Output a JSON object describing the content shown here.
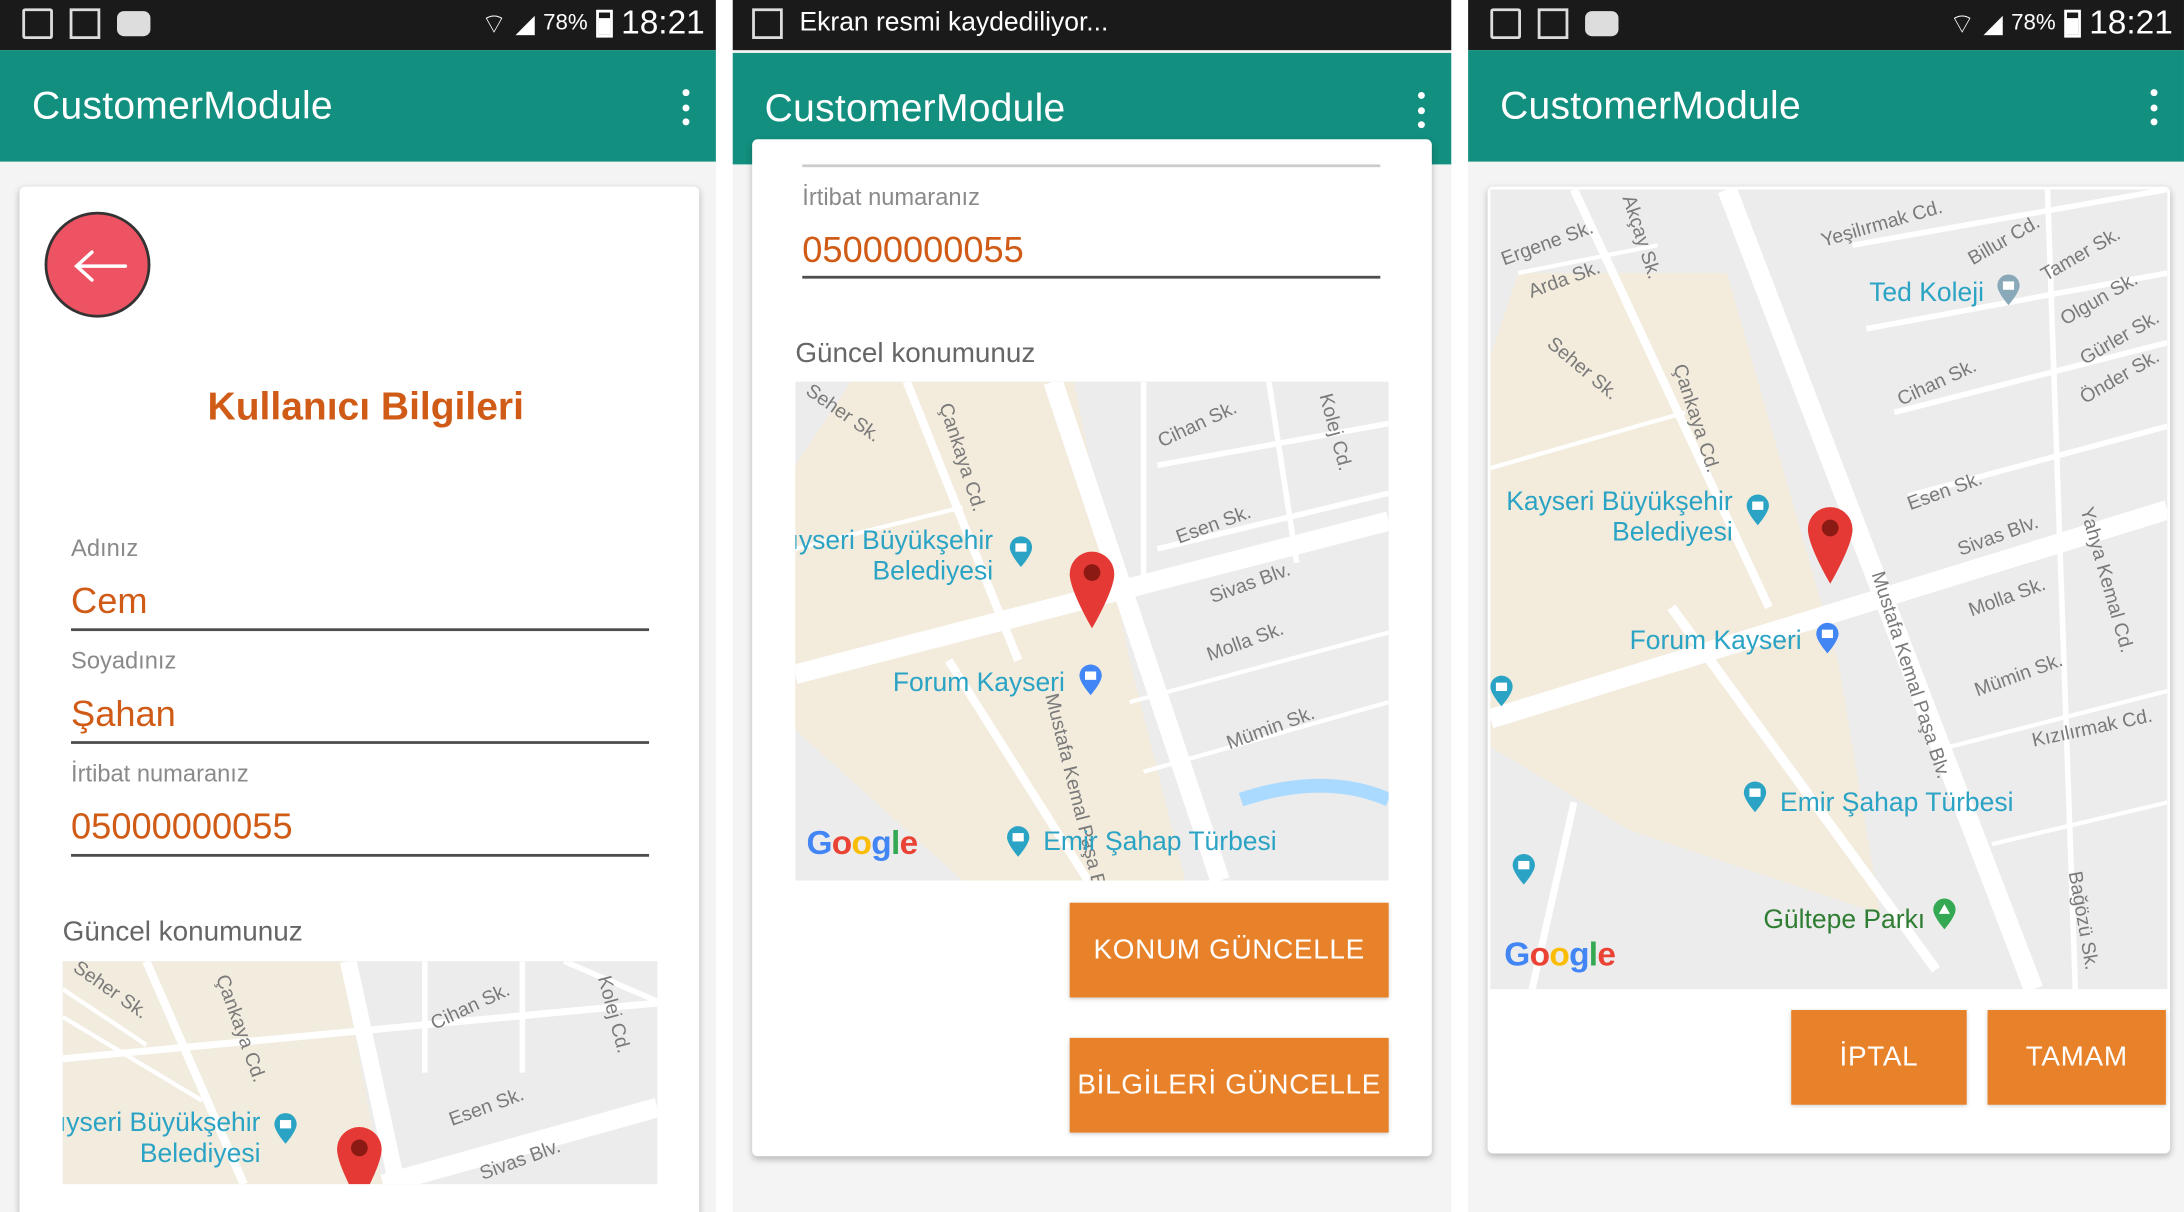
{
  "status": {
    "battery": "78%",
    "time": "18:21",
    "recording_notice": "Ekran resmi kaydediliyor..."
  },
  "app": {
    "title": "CustomerModule"
  },
  "form": {
    "heading": "Kullanıcı Bilgileri",
    "name_label": "Adınız",
    "name_value": "Cem",
    "surname_label": "Soyadınız",
    "surname_value": "Şahan",
    "phone_label": "İrtibat numaranız",
    "phone_value": "05000000055",
    "location_title": "Güncel konumunuz"
  },
  "buttons": {
    "update_location": "KONUM GÜNCELLE",
    "update_info": "BİLGİLERİ GÜNCELLE",
    "cancel": "İPTAL",
    "ok": "TAMAM"
  },
  "map": {
    "streets": {
      "seher": "Seher Sk.",
      "cankaya": "Çankaya Cd.",
      "cihan": "Cihan Sk.",
      "kolej": "Kolej Cd.",
      "esen": "Esen Sk.",
      "sivas": "Sivas Blv.",
      "molla": "Molla Sk.",
      "mumin": "Mümin Sk.",
      "mustafa": "Mustafa Kemal Paşa Blv.",
      "ergene": "Ergene Sk.",
      "arda": "Arda Sk.",
      "akcay": "Akçay Sk.",
      "yesilirmak": "Yeşilırmak Cd.",
      "billur": "Billur Cd.",
      "tamer": "Tamer Sk.",
      "olgun": "Olgun Sk.",
      "gurler": "Gürler Sk.",
      "onder": "Önder Sk.",
      "yahya": "Yahya Kemal Cd.",
      "kizilirmak": "Kızılırmak Cd.",
      "bagozu": "Bağözü Sk.",
      "truncated_buyuksehir": "ıyseri Büyükşehir"
    },
    "places": {
      "buyuksehir_line1": "Kayseri Büyükşehir",
      "buyuksehir_line2": "Belediyesi",
      "forum": "Forum Kayseri",
      "emir": "Emir Şahap Türbesi",
      "ted": "Ted Koleji",
      "gultepe": "Gültepe Parkı"
    },
    "attribution": [
      "G",
      "o",
      "o",
      "g",
      "l",
      "e"
    ]
  },
  "colors": {
    "appbar": "#128f7f",
    "accent_text": "#d05b16",
    "button": "#e8822a",
    "fab": "#ee5364",
    "pin": "#e53935",
    "poi": "#2ba3c4"
  }
}
